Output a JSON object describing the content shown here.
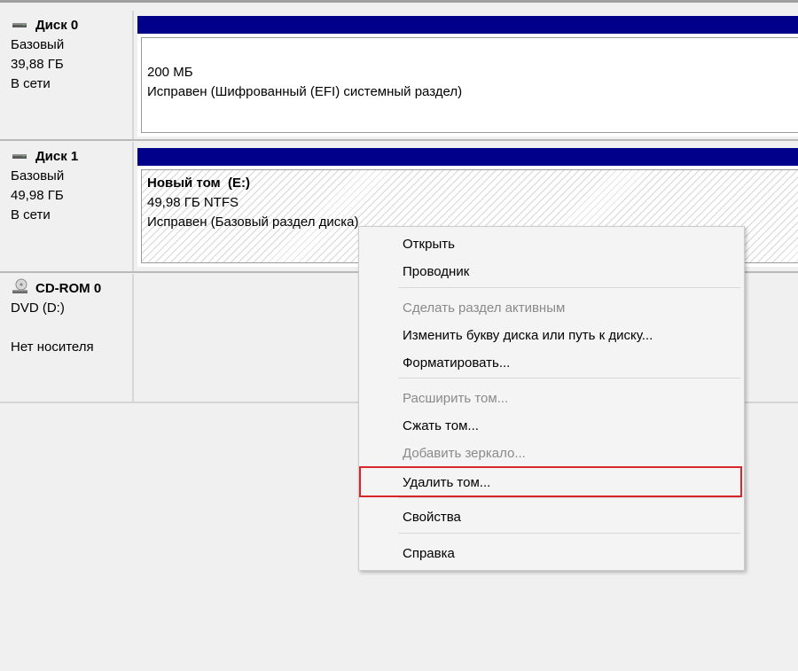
{
  "disks": [
    {
      "name": "Диск 0",
      "type": "Базовый",
      "size": "39,88 ГБ",
      "status": "В сети",
      "partition": {
        "title": "",
        "size": "200 МБ",
        "status": "Исправен (Шифрованный (EFI) системный раздел)"
      }
    },
    {
      "name": "Диск 1",
      "type": "Базовый",
      "size": "49,98 ГБ",
      "status": "В сети",
      "partition": {
        "title": "Новый том  (E:)",
        "size": "49,98 ГБ NTFS",
        "status": "Исправен (Базовый раздел диска)"
      }
    }
  ],
  "cdrom": {
    "name": "CD-ROM 0",
    "drive": "DVD (D:)",
    "status": "Нет носителя"
  },
  "context_menu": {
    "items": [
      {
        "label": "Открыть",
        "enabled": true
      },
      {
        "label": "Проводник",
        "enabled": true
      },
      {
        "label": "Сделать раздел активным",
        "enabled": false
      },
      {
        "label": "Изменить букву диска или путь к диску...",
        "enabled": true
      },
      {
        "label": "Форматировать...",
        "enabled": true
      },
      {
        "label": "Расширить том...",
        "enabled": false
      },
      {
        "label": "Сжать том...",
        "enabled": true
      },
      {
        "label": "Добавить зеркало...",
        "enabled": false
      },
      {
        "label": "Удалить том...",
        "enabled": true,
        "highlighted": true
      },
      {
        "label": "Свойства",
        "enabled": true
      },
      {
        "label": "Справка",
        "enabled": true
      }
    ]
  },
  "colors": {
    "partition_bar": "#00008b",
    "highlight_border": "#d9262b",
    "disabled_text": "#8a8a8a"
  }
}
